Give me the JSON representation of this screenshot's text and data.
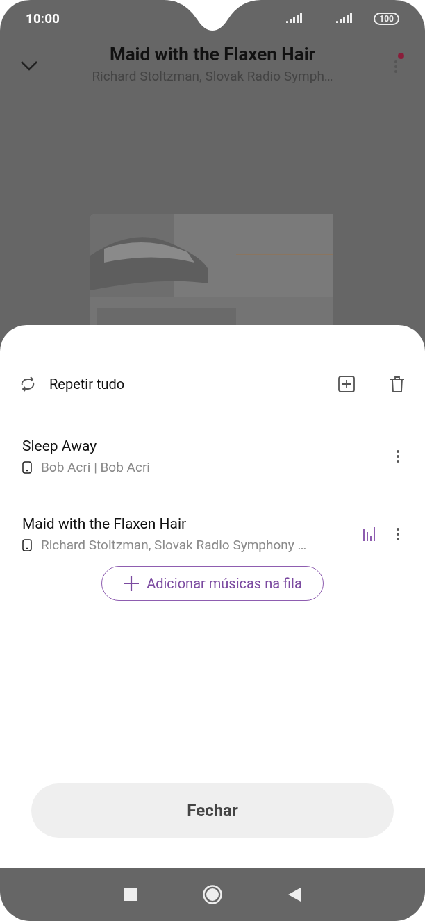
{
  "status_bar": {
    "time": "10:00",
    "battery": "100"
  },
  "now_playing": {
    "title": "Maid with the Flaxen Hair",
    "artist": "Richard Stoltzman, Slovak Radio Symph…",
    "menu_badge": true
  },
  "queue": {
    "repeat_label": "Repetir tudo",
    "items": [
      {
        "title": "Sleep Away",
        "subtitle": "Bob Acri | Bob Acri",
        "playing": false
      },
      {
        "title": "Maid with the Flaxen Hair",
        "subtitle": "Richard Stoltzman, Slovak Radio Symphony …",
        "playing": true
      }
    ],
    "add_button": "Adicionar músicas na fila",
    "close_button": "Fechar"
  }
}
